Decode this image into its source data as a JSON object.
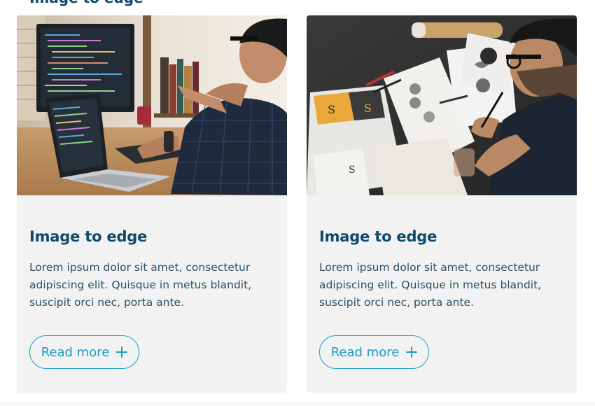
{
  "section": {
    "heading": "Image to edge"
  },
  "cards": [
    {
      "image_alt": "Developer coding at a desk with monitor and laptop",
      "title": "Image to edge",
      "text": "Lorem ipsum dolor sit amet, consectetur adipiscing elit. Quisque in metus blandit, suscipit orci nec, porta ante.",
      "button_label": "Read more",
      "button_icon": "plus-icon"
    },
    {
      "image_alt": "Designer sketching logo concepts on paper",
      "title": "Image to edge",
      "text": "Lorem ipsum dolor sit amet, consectetur adipiscing elit. Quisque in metus blandit, suscipit orci nec, porta ante.",
      "button_label": "Read more",
      "button_icon": "plus-icon"
    }
  ],
  "colors": {
    "title": "#0d4a6b",
    "body_text": "#2c4f66",
    "accent": "#1a9bc4",
    "card_bg": "#f2f2f2"
  }
}
